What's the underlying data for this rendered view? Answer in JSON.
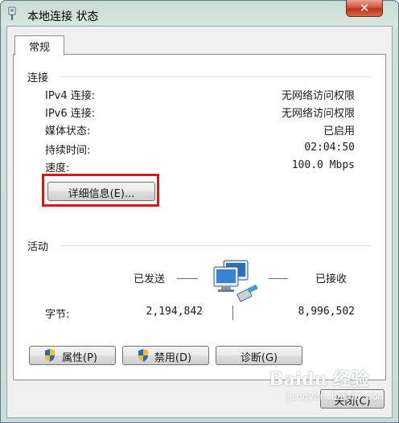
{
  "window": {
    "title": "本地连接 状态",
    "close_glyph": "✕"
  },
  "tabs": [
    {
      "label": "常规"
    }
  ],
  "connection": {
    "heading": "连接",
    "rows": [
      {
        "label": "IPv4 连接:",
        "value": "无网络访问权限"
      },
      {
        "label": "IPv6 连接:",
        "value": "无网络访问权限"
      },
      {
        "label": "媒体状态:",
        "value": "已启用"
      },
      {
        "label": "持续时间:",
        "value": "02:04:50"
      },
      {
        "label": "速度:",
        "value": "100.0 Mbps"
      }
    ],
    "details_button": "详细信息(E)..."
  },
  "activity": {
    "heading": "活动",
    "sent_label": "已发送",
    "received_label": "已接收",
    "bytes_label": "字节:",
    "bytes_sent": "2,194,842",
    "bytes_received": "8,996,502"
  },
  "buttons": {
    "properties": "属性(P)",
    "disable": "禁用(D)",
    "diagnose": "诊断(G)",
    "close": "关闭(C)"
  },
  "watermark": {
    "text": "Baidu 经验",
    "sub": "jingyan.baidu.com"
  },
  "colors": {
    "highlight": "#d21a1a",
    "close_button": "#c0331d",
    "frame": "#cbddd2"
  },
  "icons": [
    "window-network-icon",
    "network-computers-icon",
    "uac-shield-icon"
  ]
}
